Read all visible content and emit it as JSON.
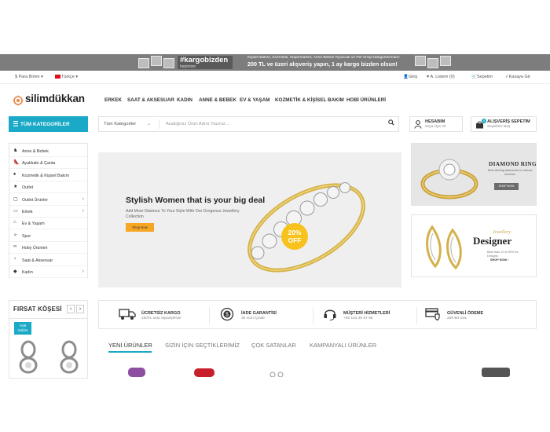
{
  "promo": {
    "brand": "#kargobizden",
    "brand_sub": "hepimize",
    "line1": "Kişisel Bakım, Kozmetik, Süpermarket, Anne-Bebek-Oyuncak ve Pet Shop kategorilerinden",
    "line2": "200 TL ve üzeri alışveriş yapın, 1 ay kargo bizden olsun!"
  },
  "topbar": {
    "currency": "$ Para Birimi ▾",
    "language": "Türkçe ▾",
    "login": "Giriş",
    "wishlist": "A. Listem (0)",
    "cart": "Sepetim",
    "checkout": "Kasaya Git"
  },
  "logo": {
    "text": "silimdükkan"
  },
  "nav": [
    "ERKEK",
    "SAAT & AKSESUAR",
    "KADIN",
    "ANNE & BEBEK",
    "EV & YAŞAM",
    "KOZMETİK & KİŞİSEL BAKIM",
    "HOBİ ÜRÜNLERİ"
  ],
  "category_button": "TÜM KATEGORİLER",
  "search": {
    "category": "Tüm Kategoriler",
    "placeholder": "Aradığınız Ürün Adını Yazınız..."
  },
  "account": {
    "title": "HESABIM",
    "sub": "veya Üye Ol"
  },
  "cart_box": {
    "count": "0",
    "title": "ALIŞVERİŞ SEPETİM",
    "sub": "Sepetiniz Boş"
  },
  "sidebar": {
    "items": [
      {
        "label": "Anne & Bebek",
        "icon": "bottle-icon"
      },
      {
        "label": "Ayakkabı & Çanta",
        "icon": "shoe-icon"
      },
      {
        "label": "Kozmetik & Kişisel Bakım",
        "icon": "lipstick-icon"
      },
      {
        "label": "Outlet",
        "icon": "tag-icon"
      },
      {
        "label": "Outlet Ürünler",
        "icon": "box-icon",
        "has_sub": true
      },
      {
        "label": "Erkek",
        "icon": "laptop-icon",
        "has_sub": true
      },
      {
        "label": "Ev & Yaşam",
        "icon": "home-icon"
      },
      {
        "label": "Spor",
        "icon": "sport-icon"
      },
      {
        "label": "Hoby Ürünleri",
        "icon": "bike-icon"
      },
      {
        "label": "Saat & Aksesuar",
        "icon": "watch-icon"
      },
      {
        "label": "Kadın",
        "icon": "diamond-icon",
        "has_sub": true
      }
    ]
  },
  "hero": {
    "title": "Stylish Women that is your big deal",
    "subtitle": "Add More Glamour To Your Style With Our Gorgeous Jewellery Collection",
    "button": "Shop Now",
    "badge_pct": "20%",
    "badge_off": "OFF"
  },
  "banner_ring": {
    "title": "DIAMOND RING",
    "text": "Real sterling diamonds for utmost services",
    "button": "SHOP NOW"
  },
  "banner_designer": {
    "script": "Jewellery",
    "title": "Designer",
    "text": "Best Sale 10 to 50% for Designs",
    "button": "SHOP NOW"
  },
  "firsat": {
    "title": "FIRSAT KÖŞESİ",
    "discount_pct": "%39",
    "discount_label": "İndirim"
  },
  "features": [
    {
      "title": "ÜCRETSİZ KARGO",
      "sub": "150TL üstü Siparişlerde",
      "icon": "truck-icon"
    },
    {
      "title": "İADE GARANTİSİ",
      "sub": "30 Gün İçinde",
      "icon": "money-back-icon"
    },
    {
      "title": "MÜŞTERİ HİZMETLERİ",
      "sub": "+90 123 45 67 89",
      "icon": "headset-icon"
    },
    {
      "title": "GÜVENLİ ÖDEME",
      "sub": "256 Bit SSL",
      "icon": "secure-card-icon"
    }
  ],
  "tabs": [
    "YENİ ÜRÜNLER",
    "SİZİN İÇİN SEÇTİKLERİMİZ",
    "ÇOK SATANLAR",
    "KAMPANYALI ÜRÜNLER"
  ],
  "colors": {
    "accent": "#1aa9c7",
    "badge": "#f7c21b",
    "hero_button": "#f6a623",
    "promo_bg": "#7d7d7d"
  }
}
